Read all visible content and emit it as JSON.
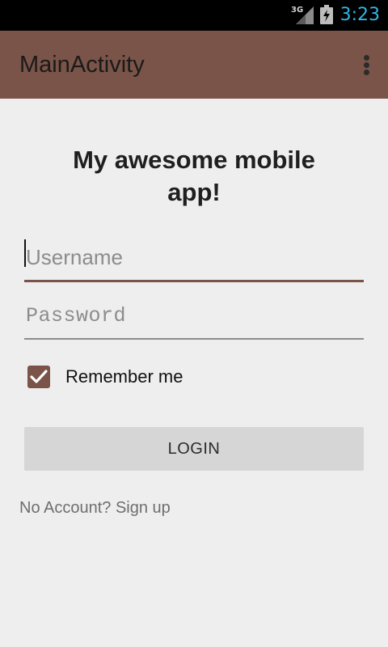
{
  "status_bar": {
    "network_label": "3G",
    "time": "3:23",
    "time_color": "#33b5e5",
    "signal_icon": "signal-strength-icon",
    "battery_icon": "battery-charging-icon"
  },
  "app_bar": {
    "title": "MainActivity",
    "background_color": "#7a5448",
    "overflow_icon": "overflow-menu-icon"
  },
  "form": {
    "headline": "My awesome mobile app!",
    "username": {
      "value": "",
      "placeholder": "Username"
    },
    "password": {
      "value": "",
      "placeholder": "Password"
    },
    "remember_me": {
      "label": "Remember me",
      "checked": true
    },
    "login_label": "LOGIN",
    "signup_text": "No Account? Sign up"
  },
  "theme": {
    "accent": "#7a5448",
    "background": "#eeeeee",
    "button_background": "#d6d6d6"
  }
}
